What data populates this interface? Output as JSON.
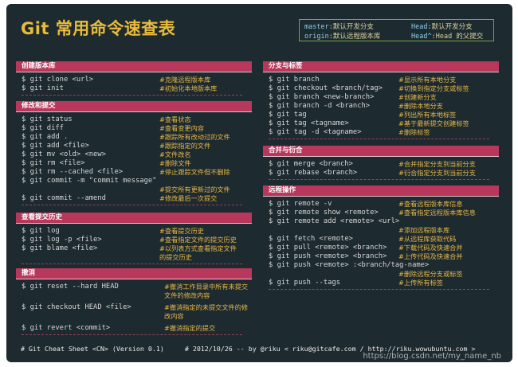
{
  "title": "Git 常用命令速查表",
  "legend": [
    {
      "key": "master",
      "text": ":默认开发分支"
    },
    {
      "key": "origin",
      "text": ":默认远程版本库"
    },
    {
      "key": "Head",
      "text": ":默认开发分支"
    },
    {
      "key": "Head^",
      "text": ":Head 的父提交"
    }
  ],
  "sections": {
    "create": {
      "title": "创建版本库",
      "rows": [
        {
          "cmd": "$ git clone <url>",
          "comment": "#克隆远程版本库"
        },
        {
          "cmd": "$ git init",
          "comment": "#初始化本地版本库"
        }
      ]
    },
    "modify": {
      "title": "修改和提交",
      "rows": [
        {
          "cmd": "$ git status",
          "comment": "#查看状态"
        },
        {
          "cmd": "$ git diff",
          "comment": "#查看变更内容"
        },
        {
          "cmd": "$ git add .",
          "comment": "#跟踪所有改动过的文件"
        },
        {
          "cmd": "$ git add <file>",
          "comment": "#跟踪指定的文件"
        },
        {
          "cmd": "$ git mv <old> <new>",
          "comment": "#文件改名"
        },
        {
          "cmd": "$ git rm <file>",
          "comment": "#删除文件"
        },
        {
          "cmd": "$ git rm --cached <file>",
          "comment": "#停止跟踪文件但不删除"
        },
        {
          "cmd": "$ git commit -m \"commit message\"",
          "comment": ""
        },
        {
          "cmd": "",
          "comment": "#提交所有更新过的文件"
        },
        {
          "cmd": "$ git commit --amend",
          "comment": "#修改最后一次提交"
        }
      ]
    },
    "history": {
      "title": "查看提交历史",
      "rows": [
        {
          "cmd": "$ git log",
          "comment": "#查看提交历史"
        },
        {
          "cmd": "$ git log -p <file>",
          "comment": "#查看指定文件的提交历史"
        },
        {
          "cmd": "$ git blame <file>",
          "comment": "#以列表方式查看指定文件"
        },
        {
          "cmd": "",
          "comment": "的提交历史"
        }
      ]
    },
    "undo": {
      "title": "撤消",
      "rows": [
        {
          "cmd": "$ git reset --hard HEAD",
          "comment": "#撤消工作目录中所有未提交"
        },
        {
          "cmd": "",
          "comment": "文件的修改内容"
        },
        {
          "cmd": "$ git checkout HEAD <file>",
          "comment": "#撤消指定的未提交文件的修"
        },
        {
          "cmd": "",
          "comment": "改内容"
        },
        {
          "cmd": "$ git revert <commit>",
          "comment": "#撤消指定的提交"
        }
      ]
    },
    "branch": {
      "title": "分支与标签",
      "rows": [
        {
          "cmd": "$ git branch",
          "comment": "#显示所有本地分支"
        },
        {
          "cmd": "$ git checkout <branch/tag>",
          "comment": "#切换到指定分支或标签"
        },
        {
          "cmd": "$ git branch <new-branch>",
          "comment": "#创建新分支"
        },
        {
          "cmd": "$ git branch -d <branch>",
          "comment": "#删除本地分支"
        },
        {
          "cmd": "$ git tag",
          "comment": "#列出所有本地标签"
        },
        {
          "cmd": "$ git tag <tagname>",
          "comment": "#基于最新提交创建标签"
        },
        {
          "cmd": "$ git tag -d <tagname>",
          "comment": "#删除标签"
        }
      ]
    },
    "merge": {
      "title": "合并与衍合",
      "rows": [
        {
          "cmd": "$ git merge <branch>",
          "comment": "#合并指定分支到当前分支"
        },
        {
          "cmd": "$ git rebase <branch>",
          "comment": "#衍合指定分支到当前分支"
        }
      ]
    },
    "remote": {
      "title": "远程操作",
      "rows": [
        {
          "cmd": "$ git remote -v",
          "comment": "#查看远程版本库信息"
        },
        {
          "cmd": "$ git remote show <remote>",
          "comment": "#查看指定远程版本库信息"
        },
        {
          "cmd": "$ git remote add <remote> <url>",
          "comment": ""
        },
        {
          "cmd": "",
          "comment": "#添加远程版本库"
        },
        {
          "cmd": "$ git fetch <remote>",
          "comment": "#从远程库获取代码"
        },
        {
          "cmd": "$ git pull <remote> <branch>",
          "comment": "#下载代码及快速合并"
        },
        {
          "cmd": "$ git push <remote> <branch>",
          "comment": "#上传代码及快速合并"
        },
        {
          "cmd": "$ git push <remote> :<branch/tag-name>",
          "comment": ""
        },
        {
          "cmd": "",
          "comment": "#删除远程分支或标签"
        },
        {
          "cmd": "$ git push --tags",
          "comment": "#上传所有标签"
        }
      ]
    }
  },
  "footer": {
    "left": "# Git Cheat Sheet <CN> (Version 0.1)",
    "middle": "# 2012/10/26  -- by @riku  < riku@gitcafe.com / http://riku.wowubuntu.com >"
  },
  "watermark": "https://blog.csdn.net/my_name_nb"
}
